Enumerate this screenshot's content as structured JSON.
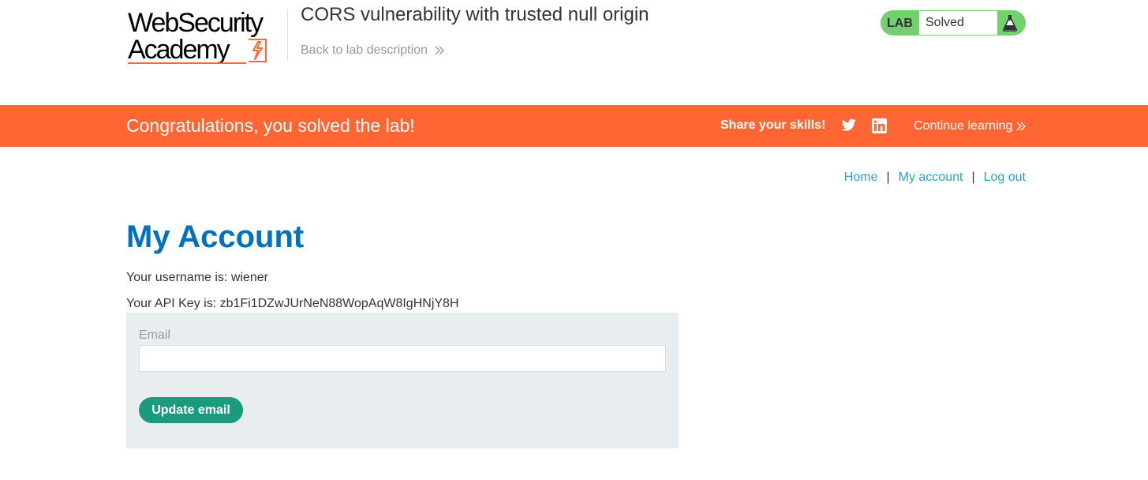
{
  "header": {
    "logo_line1": "WebSecurity",
    "logo_line2": "Academy",
    "lab_title": "CORS vulnerability with trusted null origin",
    "back_link": "Back to lab description",
    "badge": {
      "label": "LAB",
      "status": "Solved",
      "icon": "flask-icon"
    }
  },
  "banner": {
    "message": "Congratulations, you solved the lab!",
    "share_label": "Share your skills!",
    "share_icons": [
      "twitter-icon",
      "linkedin-icon"
    ],
    "continue_label": "Continue learning"
  },
  "nav": {
    "items": [
      "Home",
      "My account",
      "Log out"
    ],
    "separator": "|"
  },
  "main": {
    "title": "My Account",
    "username_line": "Your username is: wiener",
    "apikey_line": "Your API Key is: zb1Fi1DZwJUrNeN88WopAqW8IgHNjY8H",
    "form": {
      "email_label": "Email",
      "email_value": "",
      "submit_label": "Update email"
    }
  },
  "colors": {
    "brand_orange": "#ff6633",
    "badge_green": "#70d16d",
    "link_blue": "#29a0d8",
    "title_blue": "#0071bc",
    "button_green": "#1a9b7e",
    "form_bg": "#e8eef0"
  }
}
